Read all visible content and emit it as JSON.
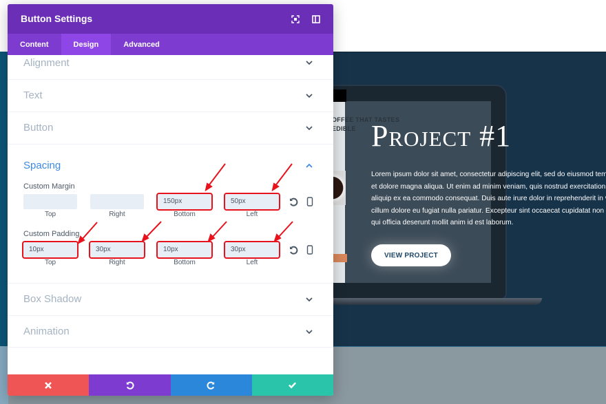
{
  "modal": {
    "title": "Button Settings",
    "header_icons": [
      "fullscreen-icon",
      "split-view-icon"
    ],
    "tabs": [
      {
        "label": "Content",
        "active": false
      },
      {
        "label": "Design",
        "active": true
      },
      {
        "label": "Advanced",
        "active": false
      }
    ],
    "sections": {
      "alignment": {
        "label": "Alignment",
        "expanded": false
      },
      "text": {
        "label": "Text",
        "expanded": false
      },
      "button": {
        "label": "Button",
        "expanded": false
      },
      "spacing": {
        "label": "Spacing",
        "expanded": true
      },
      "box_shadow": {
        "label": "Box Shadow",
        "expanded": false
      },
      "animation": {
        "label": "Animation",
        "expanded": false
      }
    },
    "spacing": {
      "custom_margin": {
        "label": "Custom Margin",
        "fields": [
          {
            "caption": "Top",
            "value": "",
            "highlighted": false
          },
          {
            "caption": "Right",
            "value": "",
            "highlighted": false
          },
          {
            "caption": "Bottom",
            "value": "150px",
            "highlighted": true
          },
          {
            "caption": "Left",
            "value": "50px",
            "highlighted": true
          }
        ]
      },
      "custom_padding": {
        "label": "Custom Padding",
        "fields": [
          {
            "caption": "Top",
            "value": "10px",
            "highlighted": true
          },
          {
            "caption": "Right",
            "value": "30px",
            "highlighted": true
          },
          {
            "caption": "Bottom",
            "value": "10px",
            "highlighted": true
          },
          {
            "caption": "Left",
            "value": "30px",
            "highlighted": true
          }
        ]
      }
    },
    "footer": {
      "buttons": [
        "cancel",
        "undo",
        "redo",
        "save"
      ]
    },
    "colors": {
      "header": "#6b2eb6",
      "tabs": "#7e3bd0",
      "active_tab": "#8f46e7",
      "cancel": "#ef5555",
      "undo": "#7e3bd0",
      "redo": "#2b87da",
      "save": "#29c4a9",
      "annotation_red": "#e7121b"
    }
  },
  "preview": {
    "title": "Project #1",
    "body_lines": [
      "Lorem ipsum dolor sit amet, consectetur adipiscing elit, sed do eiusmod tempor in",
      "et dolore magna aliqua. Ut enim ad minim veniam, quis nostrud exercitation ullam",
      "aliquip ex ea commodo consequat. Duis aute irure dolor in reprehenderit in volupt",
      "cillum dolore eu fugiat nulla pariatur. Excepteur sint occaecat cupidatat non proid",
      "qui officia deserunt mollit anim id est laborum."
    ],
    "button_label": "VIEW PROJECT",
    "mockup_snippet_lines": [
      "OFFEE THAT TASTES",
      "EDIBLE"
    ],
    "colors": {
      "hero_bg": "#17334a",
      "bottom_band": "#8a989f"
    }
  }
}
